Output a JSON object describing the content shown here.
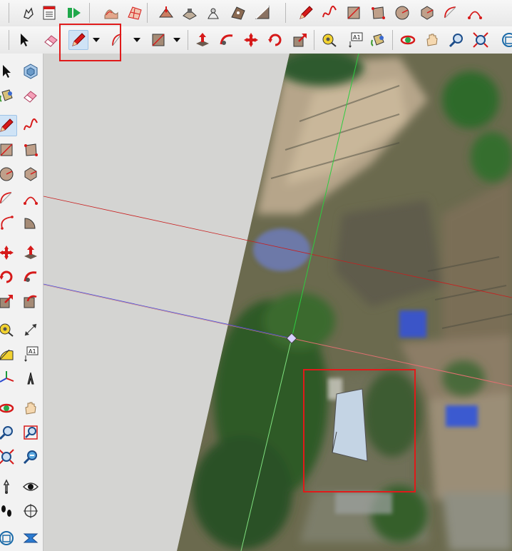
{
  "toolbar_top": [
    {
      "name": "lasso-select-icon",
      "icon": "hand-arrow"
    },
    {
      "name": "outliner-icon",
      "icon": "list-doc"
    },
    {
      "name": "scenes-icon",
      "icon": "green-play"
    },
    {
      "name": "sandbox-from-contours-icon",
      "icon": "terrain-contours"
    },
    {
      "name": "sandbox-from-scratch-icon",
      "icon": "terrain-grid"
    },
    {
      "name": "smoove-icon",
      "icon": "terrain-smoove"
    },
    {
      "name": "stamp-icon",
      "icon": "terrain-stamp"
    },
    {
      "name": "drape-icon",
      "icon": "terrain-drape"
    },
    {
      "name": "add-detail-icon",
      "icon": "terrain-detail"
    },
    {
      "name": "flip-edge-icon",
      "icon": "terrain-flip"
    },
    {
      "name": "line-tool-icon",
      "icon": "pencil"
    },
    {
      "name": "freehand-icon",
      "icon": "squiggle"
    },
    {
      "name": "rectangle-icon",
      "icon": "rect"
    },
    {
      "name": "rotated-rectangle-icon",
      "icon": "rot-rect"
    },
    {
      "name": "circle-icon",
      "icon": "circle"
    },
    {
      "name": "polygon-icon",
      "icon": "polygon"
    },
    {
      "name": "arc-icon",
      "icon": "arc"
    },
    {
      "name": "two-point-arc-icon",
      "icon": "arc2"
    }
  ],
  "toolbar_second": [
    {
      "name": "select-icon",
      "icon": "arrow"
    },
    {
      "name": "eraser-icon",
      "icon": "eraser"
    },
    {
      "name": "line-tool-icon",
      "icon": "pencil",
      "active": true
    },
    {
      "name": "arc-dropdown-icon",
      "icon": "arc-pie"
    },
    {
      "name": "rectangle-dropdown-icon",
      "icon": "rect-brown"
    },
    {
      "name": "push-pull-icon",
      "icon": "pushpull"
    },
    {
      "name": "follow-me-icon",
      "icon": "followme"
    },
    {
      "name": "move-icon",
      "icon": "move"
    },
    {
      "name": "rotate-icon",
      "icon": "rotate"
    },
    {
      "name": "scale-icon",
      "icon": "scale"
    },
    {
      "name": "tape-measure-icon",
      "icon": "tape"
    },
    {
      "name": "text-tool-icon",
      "icon": "text",
      "label": "A1"
    },
    {
      "name": "paint-bucket-icon",
      "icon": "bucket"
    },
    {
      "name": "orbit-icon",
      "icon": "orbit"
    },
    {
      "name": "pan-icon",
      "icon": "hand"
    },
    {
      "name": "zoom-icon",
      "icon": "zoom"
    },
    {
      "name": "zoom-extents-icon",
      "icon": "zoom-ext"
    },
    {
      "name": "warehouse-icon",
      "icon": "warehouse"
    }
  ],
  "left_palette": [
    [
      "select-icon",
      "component-icon"
    ],
    [
      "paint-bucket-icon",
      "eraser-icon"
    ],
    [
      "line-tool-icon",
      "freehand-icon"
    ],
    [
      "rectangle-icon",
      "rotated-rectangle-icon"
    ],
    [
      "circle-icon",
      "polygon-icon"
    ],
    [
      "arc-icon",
      "two-point-arc-icon"
    ],
    [
      "three-point-arc-icon",
      "pie-icon"
    ],
    [
      "move-icon",
      "push-pull-icon"
    ],
    [
      "rotate-icon",
      "follow-me-icon"
    ],
    [
      "scale-icon",
      "offset-icon"
    ],
    [
      "tape-measure-icon",
      "dimension-icon"
    ],
    [
      "protractor-icon",
      "text-tool-icon"
    ],
    [
      "axes-icon",
      "3d-text-icon"
    ],
    [
      "orbit-icon",
      "pan-icon"
    ],
    [
      "zoom-icon",
      "zoom-window-icon"
    ],
    [
      "zoom-extents-icon",
      "previous-view-icon"
    ],
    [
      "position-camera-icon",
      "look-around-icon"
    ],
    [
      "walk-icon",
      "section-plane-icon"
    ],
    [
      "warehouse-icon",
      "extension-icon"
    ]
  ],
  "text_tool_label": "A1",
  "colors": {
    "red_axis": "#c81e1e",
    "green_axis": "#2ecc40",
    "blue_axis": "#4a4ad8",
    "highlight": "#e01a1a",
    "face": "#c4d4e4"
  }
}
